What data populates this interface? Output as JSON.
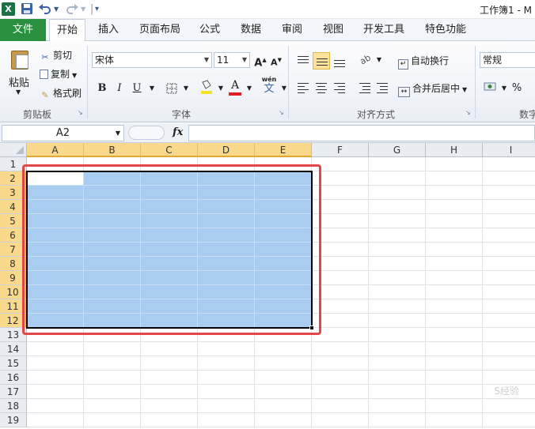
{
  "titlebar": {
    "app_icon": "X",
    "save_icon": "save-icon",
    "undo_icon": "undo-icon",
    "redo_icon": "redo-icon",
    "doc_title": "工作簿1 - M"
  },
  "tabs": {
    "file": "文件",
    "items": [
      "开始",
      "插入",
      "页面布局",
      "公式",
      "数据",
      "审阅",
      "视图",
      "开发工具",
      "特色功能"
    ],
    "active_index": 0
  },
  "ribbon": {
    "clipboard": {
      "paste": "粘贴",
      "cut": "剪切",
      "copy": "复制",
      "format_painter": "格式刷",
      "group_label": "剪贴板"
    },
    "font": {
      "font_name": "宋体",
      "font_size": "11",
      "grow": "A",
      "shrink": "A",
      "bold": "B",
      "italic": "I",
      "underline": "U",
      "phonetic": "wén",
      "phonetic_char": "文",
      "font_color_letter": "A",
      "group_label": "字体"
    },
    "alignment": {
      "wrap_text": "自动换行",
      "merge_center": "合并后居中",
      "group_label": "对齐方式"
    },
    "number": {
      "format": "常规",
      "percent": "%",
      "group_label": "数字"
    }
  },
  "formula_bar": {
    "name_box": "A2",
    "fx": "fx",
    "formula": ""
  },
  "sheet": {
    "columns": [
      "A",
      "B",
      "C",
      "D",
      "E",
      "F",
      "G",
      "H",
      "I"
    ],
    "rows": [
      "1",
      "2",
      "3",
      "4",
      "5",
      "6",
      "7",
      "8",
      "9",
      "10",
      "11",
      "12",
      "13",
      "14",
      "15",
      "16",
      "17",
      "18",
      "19"
    ],
    "selection": "A2:E12",
    "active_cell": "A2"
  },
  "watermark": "S经验"
}
